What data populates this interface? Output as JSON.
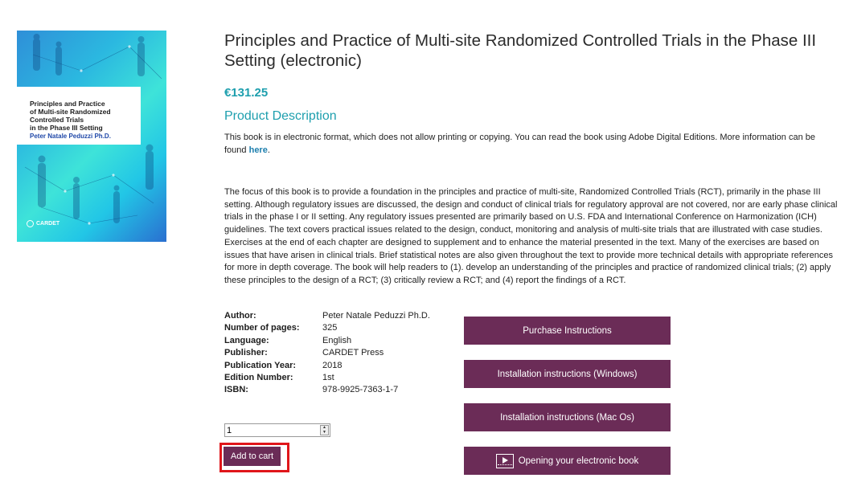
{
  "product": {
    "title": "Principles and Practice of Multi-site Randomized Controlled Trials in the Phase III Setting (electronic)",
    "price": "€131.25",
    "description_heading": "Product Description",
    "intro_text": "This book is in electronic format, which does not allow printing or copying. You can read the book using Adobe Digital Editions. More information can be found ",
    "intro_link": "here",
    "intro_end": ".",
    "body_text": "The focus of this book is to provide a foundation in the principles and practice of multi-site, Randomized Controlled Trials (RCT), primarily in the phase III setting. Although regulatory issues are discussed, the design and conduct of clinical trials for regulatory approval are not covered, nor are early phase clinical trials in the phase I or II setting. Any regulatory issues presented are primarily based on U.S. FDA and International Conference on Harmonization (ICH) guidelines. The text covers practical issues related to the design, conduct, monitoring and analysis of multi-site trials that are illustrated with case studies. Exercises at the end of each chapter are designed to supplement and to enhance the material presented in the text. Many of the exercises are based on issues that have arisen in clinical trials. Brief statistical notes are also given throughout the text to provide more technical details with appropriate references for more in depth coverage. The book will help readers to (1). develop an understanding of the principles and practice of randomized clinical trials; (2) apply these principles to the design of a RCT; (3) critically review a RCT; and (4) report the findings of a RCT."
  },
  "cover": {
    "title": "Principles and Practice\nof Multi-site Randomized\nControlled Trials\nin the Phase III Setting",
    "author": "Peter Natale Peduzzi Ph.D.",
    "publisher_logo": "CARDET",
    "colors": {
      "gradient_start": "#2f8fd8",
      "gradient_mid": "#3ee3d9",
      "author_text": "#2048a8"
    }
  },
  "details": [
    {
      "label": "Author:",
      "value": "Peter Natale Peduzzi Ph.D."
    },
    {
      "label": "Number of pages:",
      "value": "325"
    },
    {
      "label": "Language:",
      "value": "English"
    },
    {
      "label": "Publisher:",
      "value": "CARDET Press"
    },
    {
      "label": "Publication Year:",
      "value": "2018"
    },
    {
      "label": "Edition Number:",
      "value": "1st"
    },
    {
      "label": "ISBN:",
      "value": "978-9925-7363-1-7"
    }
  ],
  "cart": {
    "quantity": "1",
    "add_label": "Add to cart"
  },
  "buttons": {
    "purchase": "Purchase Instructions",
    "windows": "Installation instructions (Windows)",
    "mac": "Installation instructions (Mac Os)",
    "opening": "Opening your electronic book",
    "opening_icon": "video-player-icon"
  },
  "colors": {
    "accent_teal": "#1e9fae",
    "button_purple": "#6b2c57",
    "highlight_red": "#e0161b"
  }
}
